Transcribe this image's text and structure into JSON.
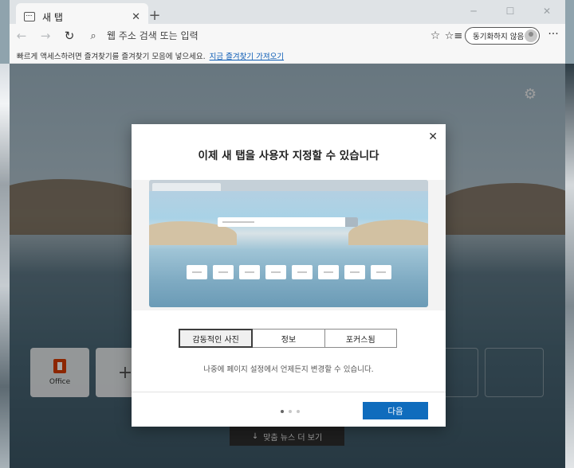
{
  "browser": {
    "tab_title": "새 탭",
    "tab_close": "✕",
    "new_tab": "+",
    "address_placeholder": "웹 주소 검색 또는 입력",
    "sync_label": "동기화하지 않음",
    "more": "···"
  },
  "favorites_bar": {
    "message": "빠르게 액세스하려면 즐겨찾기를 즐겨찾기 모음에 넣으세요.",
    "link": "지금 즐겨찾기 가져오기"
  },
  "new_tab_page": {
    "tiles": [
      {
        "label": "Office"
      },
      {
        "label": "+"
      }
    ],
    "news_button": "맞춤 뉴스 더 보기"
  },
  "dialog": {
    "title": "이제 새 탭을 사용자 지정할 수 있습니다",
    "options": [
      "감동적인 사진",
      "정보",
      "포커스됨"
    ],
    "selected_option": "감동적인 사진",
    "note": "나중에 페이지 설정에서 언제든지 변경할 수 있습니다.",
    "next_button": "다음",
    "page_dots": 3,
    "active_dot": 1
  }
}
